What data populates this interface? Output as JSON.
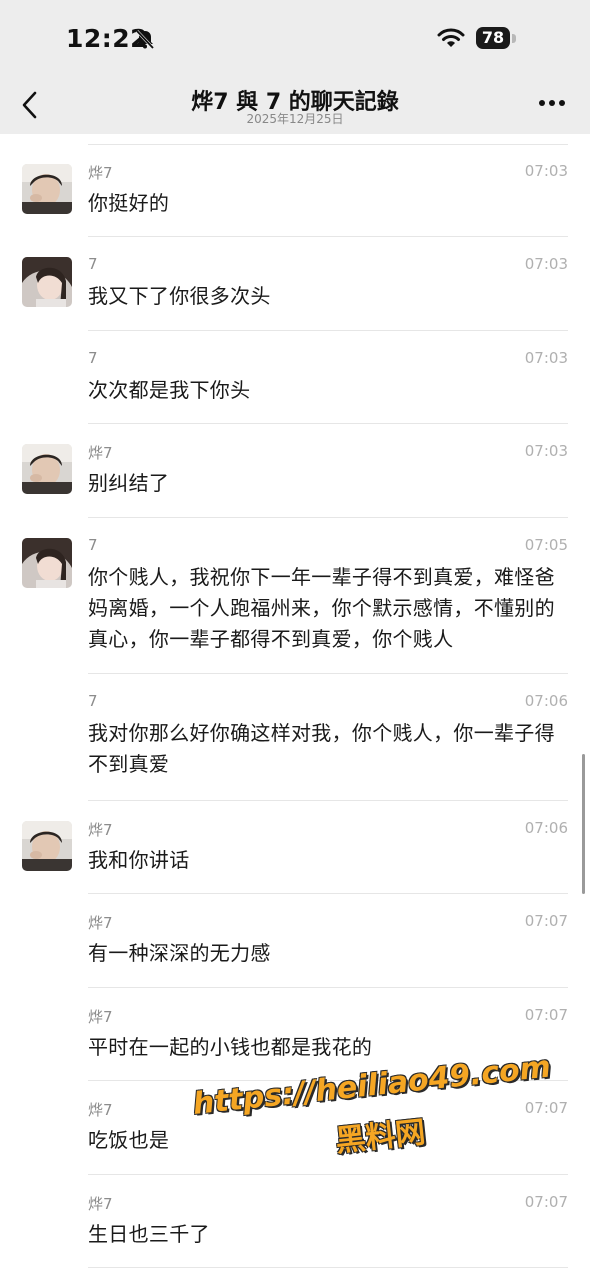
{
  "status": {
    "time": "12:22",
    "battery": "78"
  },
  "nav": {
    "title": "烨7 與 7 的聊天記錄",
    "subtitle": "2025年12月25日"
  },
  "messages": [
    {
      "sender": "烨7",
      "time": "07:03",
      "text": "你挺好的",
      "avatar": "male"
    },
    {
      "sender": "7",
      "time": "07:03",
      "text": "我又下了你很多次头",
      "avatar": "female"
    },
    {
      "sender": "7",
      "time": "07:03",
      "text": "次次都是我下你头",
      "avatar": ""
    },
    {
      "sender": "烨7",
      "time": "07:03",
      "text": "别纠结了",
      "avatar": "male"
    },
    {
      "sender": "7",
      "time": "07:05",
      "text": "你个贱人，我祝你下一年一辈子得不到真爱，难怪爸妈离婚，一个人跑福州来，你个默示感情，不懂别的真心，你一辈子都得不到真爱，你个贱人",
      "avatar": "female"
    },
    {
      "sender": "7",
      "time": "07:06",
      "text": "我对你那么好你确这样对我，你个贱人，你一辈子得不到真爱",
      "avatar": ""
    },
    {
      "sender": "烨7",
      "time": "07:06",
      "text": "我和你讲话",
      "avatar": "male"
    },
    {
      "sender": "烨7",
      "time": "07:07",
      "text": "有一种深深的无力感",
      "avatar": ""
    },
    {
      "sender": "烨7",
      "time": "07:07",
      "text": "平时在一起的小钱也都是我花的",
      "avatar": ""
    },
    {
      "sender": "烨7",
      "time": "07:07",
      "text": "吃饭也是",
      "avatar": ""
    },
    {
      "sender": "烨7",
      "time": "07:07",
      "text": "生日也三千了",
      "avatar": ""
    }
  ],
  "watermark": {
    "url": "https://heiliao49.com",
    "name": "黑料网"
  }
}
